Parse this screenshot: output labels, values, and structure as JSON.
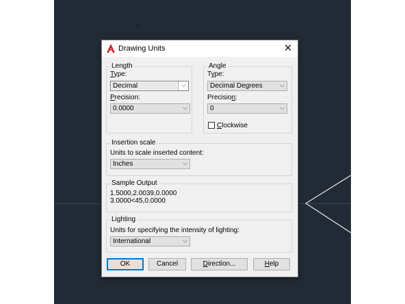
{
  "dialog": {
    "title": "Drawing Units",
    "close_glyph": "✕",
    "icon": "autocad-a-icon"
  },
  "length": {
    "legend": "Length",
    "type_label": {
      "mnemonic": "T",
      "rest": "ype:"
    },
    "type_value": "Decimal",
    "precision_label": {
      "mnemonic": "P",
      "rest": "recision:"
    },
    "precision_value": "0.0000"
  },
  "angle": {
    "legend": "Angle",
    "type_label": {
      "pre": "T",
      "mnemonic": "y",
      "rest": "pe:"
    },
    "type_value": "Decimal Degrees",
    "precision_label": {
      "pre": "Precisio",
      "mnemonic": "n",
      "rest": ":"
    },
    "precision_value": "0",
    "clockwise_label": {
      "mnemonic": "C",
      "rest": "lockwise"
    },
    "clockwise_checked": false
  },
  "insertion": {
    "legend": "Insertion scale",
    "prompt": "Units to scale inserted content:",
    "value": "Inches"
  },
  "sample": {
    "legend": "Sample Output",
    "line1": "1.5000,2.0039,0.0000",
    "line2": "3.0000<45,0.0000"
  },
  "lighting": {
    "legend": "Lighting",
    "prompt": "Units for specifying the intensity of lighting:",
    "value": "International"
  },
  "buttons": {
    "ok": "OK",
    "cancel": "Cancel",
    "direction": {
      "mnemonic": "D",
      "rest": "irection..."
    },
    "help": {
      "mnemonic": "H",
      "rest": "elp"
    }
  },
  "colors": {
    "canvas_bg": "#222a36",
    "default_button_border": "#0078d7",
    "app_icon_red": "#d42027"
  }
}
